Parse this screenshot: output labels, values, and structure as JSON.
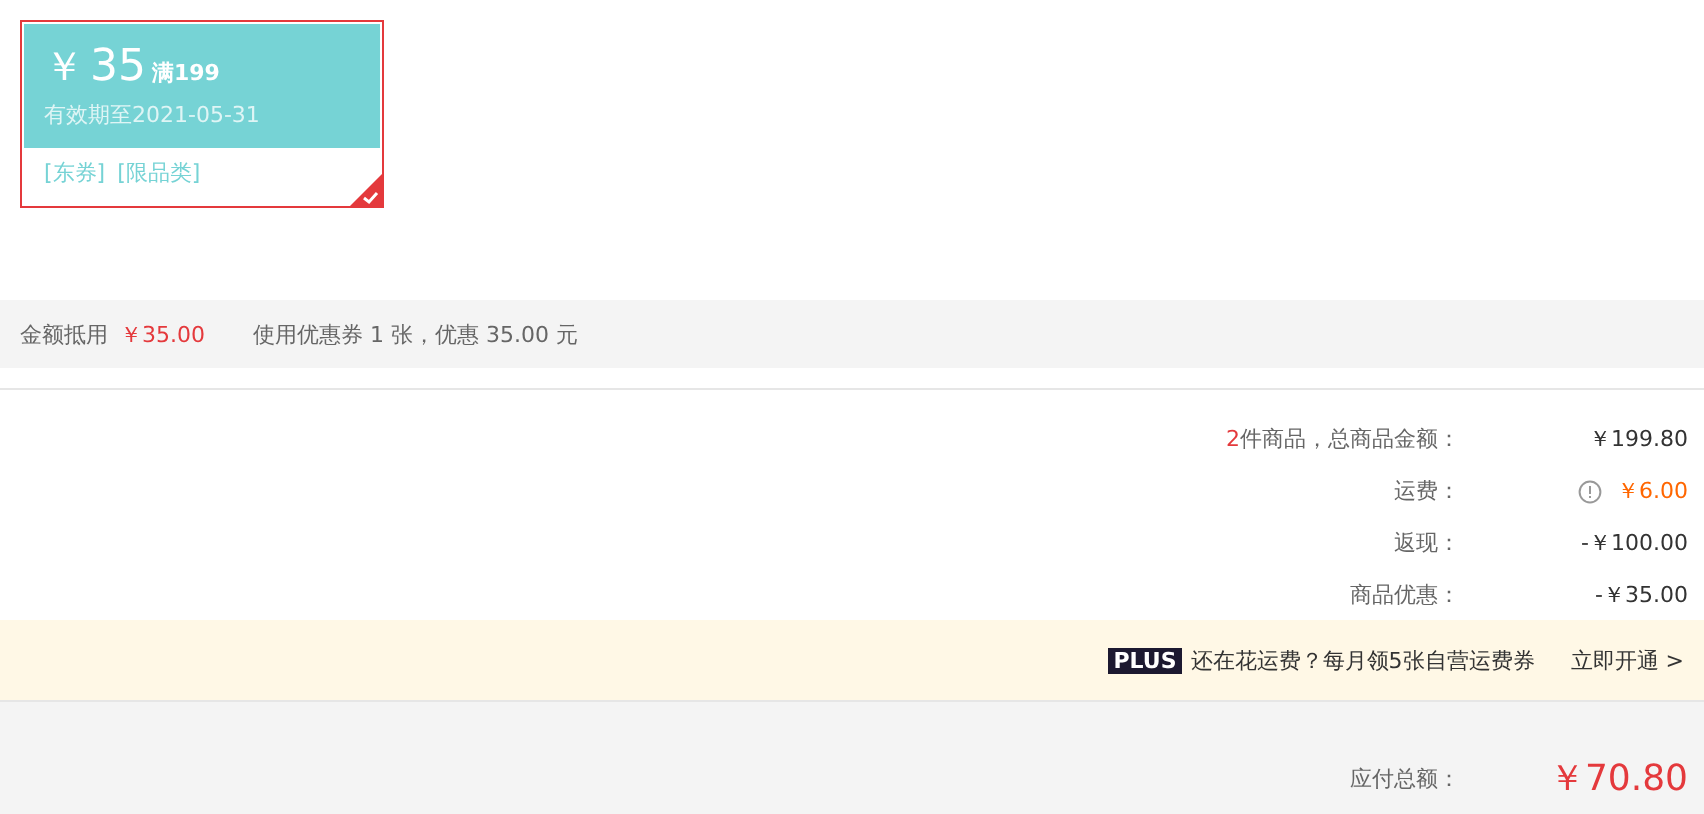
{
  "coupon": {
    "currency": "￥",
    "amount": "35",
    "condition": "满199",
    "validity": "有效期至2021-05-31",
    "tags": [
      "[东券]",
      "[限品类]"
    ],
    "selected": true
  },
  "deduction": {
    "label": "金额抵用",
    "amount": "￥35.00",
    "note": "使用优惠券 1 张，优惠 35.00 元"
  },
  "summary": [
    {
      "kind": "count",
      "count": "2",
      "label": "件商品，总商品金额：",
      "value": "￥199.80"
    },
    {
      "kind": "shipping",
      "label": "运费：",
      "value": "￥6.00"
    },
    {
      "kind": "plain",
      "label": "返现：",
      "value": "-￥100.00"
    },
    {
      "kind": "plain",
      "label": "商品优惠：",
      "value": "-￥35.00"
    }
  ],
  "plus_banner": {
    "badge": "PLUS",
    "text": "还在花运费？每月领5张自营运费券",
    "link": "立即开通",
    "arrow": ">"
  },
  "total": {
    "label": "应付总额：",
    "value": "￥70.80"
  }
}
